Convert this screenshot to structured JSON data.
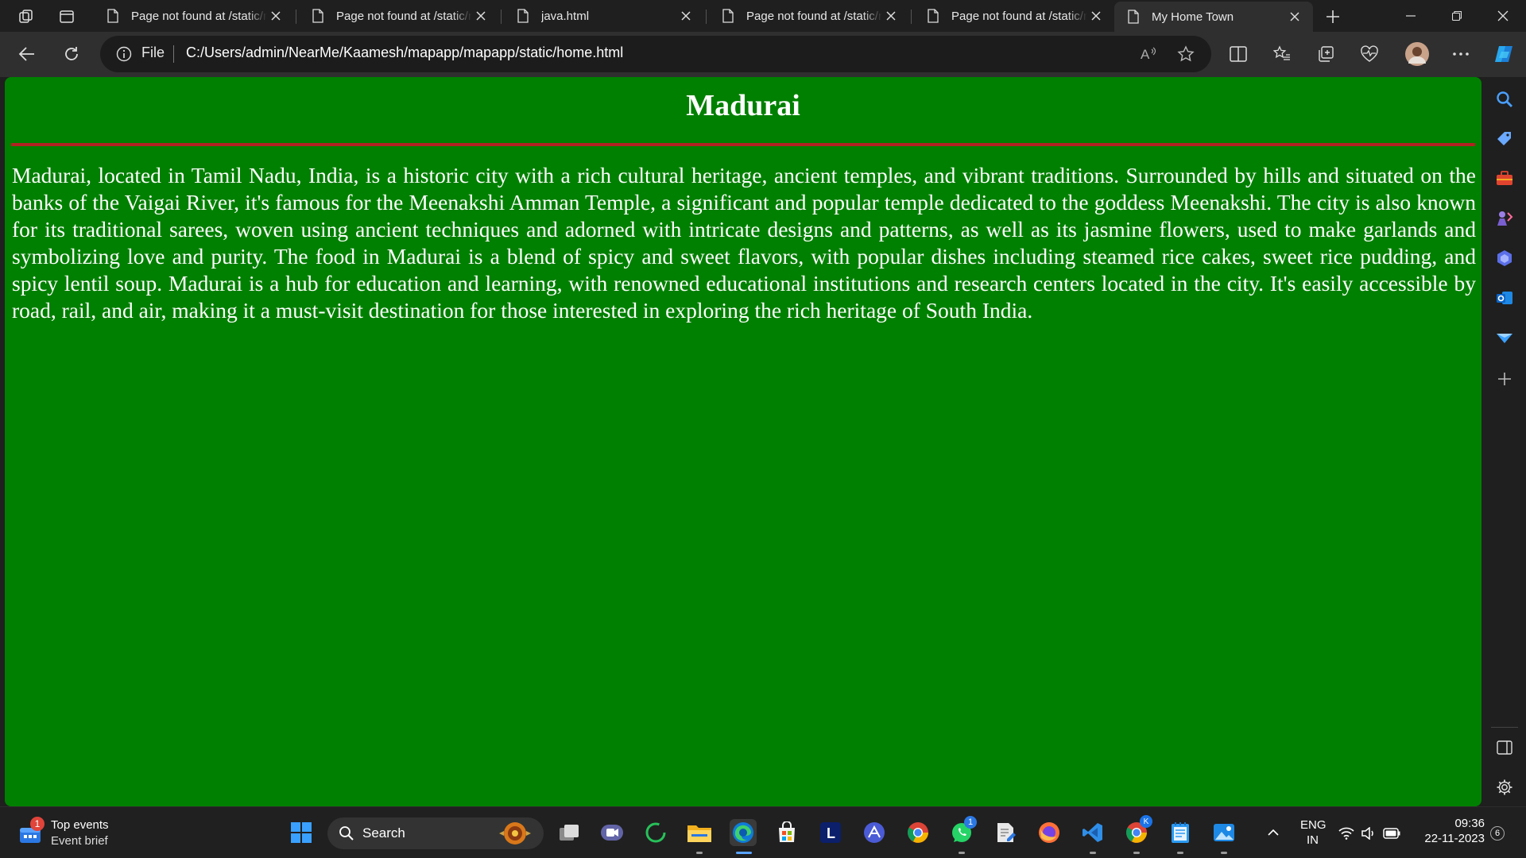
{
  "browser": {
    "tabs": [
      {
        "title": "Page not found at /static/map",
        "active": false
      },
      {
        "title": "Page not found at /static/map",
        "active": false
      },
      {
        "title": "java.html",
        "active": false
      },
      {
        "title": "Page not found at /static/map",
        "active": false
      },
      {
        "title": "Page not found at /static/map",
        "active": false
      },
      {
        "title": "My Home Town",
        "active": true
      }
    ],
    "address": {
      "protocol_label": "File",
      "url": "C:/Users/admin/NearMe/Kaamesh/mapapp/mapapp/static/home.html"
    }
  },
  "page": {
    "heading": "Madurai",
    "paragraph": "Madurai, located in Tamil Nadu, India, is a historic city with a rich cultural heritage, ancient temples, and vibrant traditions. Surrounded by hills and situated on the banks of the Vaigai River, it's famous for the Meenakshi Amman Temple, a significant and popular temple dedicated to the goddess Meenakshi. The city is also known for its traditional sarees, woven using ancient techniques and adorned with intricate designs and patterns, as well as its jasmine flowers, used to make garlands and symbolizing love and purity. The food in Madurai is a blend of spicy and sweet flavors, with popular dishes including steamed rice cakes, sweet rice pudding, and spicy lentil soup. Madurai is a hub for education and learning, with renowned educational institutions and research centers located in the city. It's easily accessible by road, rail, and air, making it a must-visit destination for those interested in exploring the rich heritage of South India.",
    "background_color": "#008000",
    "rule_color": "#b22222"
  },
  "taskbar": {
    "widget": {
      "badge": "1",
      "title": "Top events",
      "subtitle": "Event brief"
    },
    "search_placeholder": "Search",
    "whatsapp_badge": "1",
    "chrome_profile_badge": "K",
    "language": {
      "lang": "ENG",
      "region": "IN"
    },
    "clock": {
      "time": "09:36",
      "date": "22-11-2023"
    },
    "notification_count": "6"
  }
}
